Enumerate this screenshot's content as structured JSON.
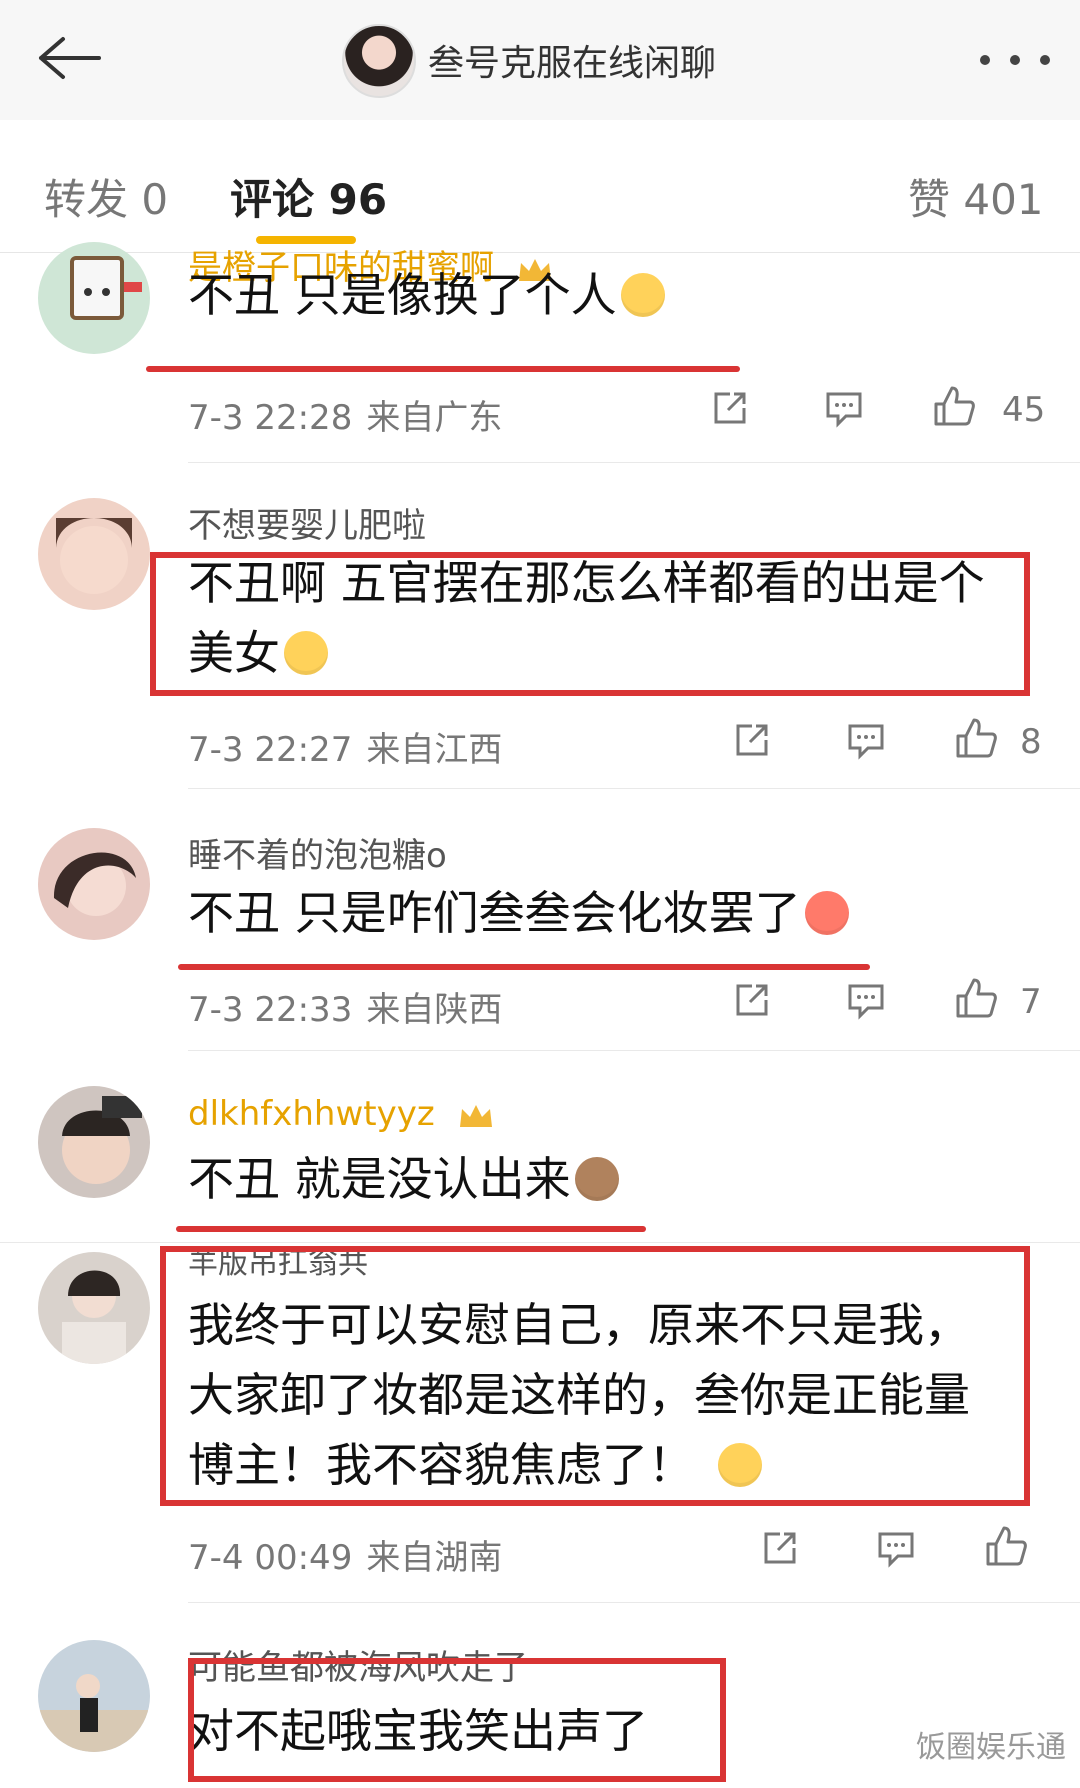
{
  "header": {
    "title": "叁号克服在线闲聊"
  },
  "tabs": [
    {
      "label": "转发 0"
    },
    {
      "label": "评论 96"
    },
    {
      "label": "赞 401"
    }
  ],
  "comments": [
    {
      "username": "是橙子口味的甜蜜啊",
      "text": "不丑 只是像换了个人",
      "time": "7-3 22:28",
      "source": "来自广东",
      "likes": "45",
      "avatar_color": "#cfe6d6"
    },
    {
      "username": "不想要婴儿肥啦",
      "text_line1": "不丑啊 五官摆在那怎么样都看的出是个",
      "text_line2": "美女",
      "time": "7-3 22:27",
      "source": "来自江西",
      "likes": "8",
      "avatar_color": "#f0d2c6"
    },
    {
      "username": "睡不着的泡泡糖o",
      "text": "不丑  只是咋们叁叁会化妆罢了",
      "time": "7-3 22:33",
      "source": "来自陕西",
      "likes": "7",
      "avatar_color": "#e8c9c2"
    },
    {
      "username": "dlkhfxhhwtyyz",
      "text": "不丑 就是没认出来",
      "avatar_color": "#cfc5c0",
      "avatar_badge": "胜利"
    },
    {
      "username": "羊版吊扛翁共",
      "text_line1": "我终于可以安慰自己，原来不只是我，",
      "text_line2": "大家卸了妆都是这样的，叁你是正能量",
      "text_line3": "博主！我不容貌焦虑了！",
      "time": "7-4 00:49",
      "source": "来自湖南",
      "avatar_color": "#d9d2cc"
    },
    {
      "username": "可能鱼都被海风吹走了",
      "text": "对不起哦宝我笑出声了",
      "avatar_color": "#c7d3dd"
    }
  ],
  "watermark": "饭圈娱乐通",
  "colors": {
    "highlight_red": "#d93434",
    "tab_accent": "#f5b400",
    "vip_name": "#e6a200"
  }
}
